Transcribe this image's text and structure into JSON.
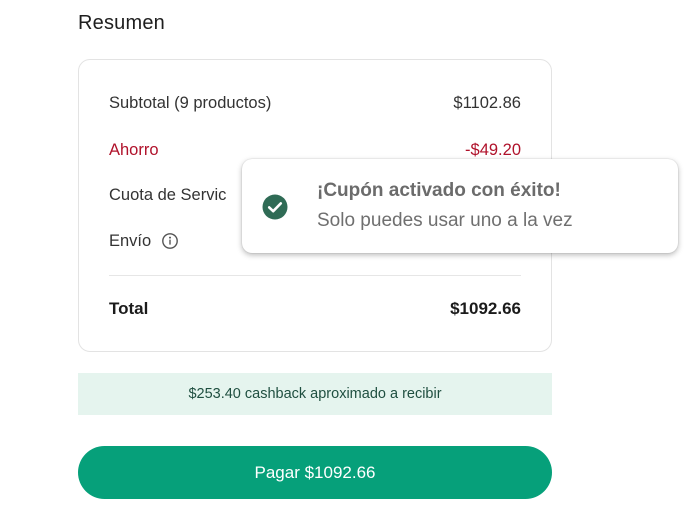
{
  "summary": {
    "title": "Resumen",
    "rows": [
      {
        "label": "Subtotal (9 productos)",
        "value": "$1102.86"
      },
      {
        "label": "Ahorro",
        "value": "-$49.20"
      },
      {
        "label": "Cuota de Servic",
        "value": ""
      },
      {
        "label": "Envío",
        "value": ""
      }
    ],
    "total_label": "Total",
    "total_value": "$1092.66"
  },
  "cashback": {
    "text": "$253.40 cashback aproximado a recibir"
  },
  "pay_button": {
    "label": "Pagar $1092.66"
  },
  "toast": {
    "title": "¡Cupón activado con éxito!",
    "message": "Solo puedes usar uno a la vez",
    "icon": "check-circle-icon"
  },
  "colors": {
    "accent": "#06a07a",
    "savings": "#b0122b",
    "cashback_bg": "#e5f4ee",
    "toast_icon": "#2f6b55"
  }
}
